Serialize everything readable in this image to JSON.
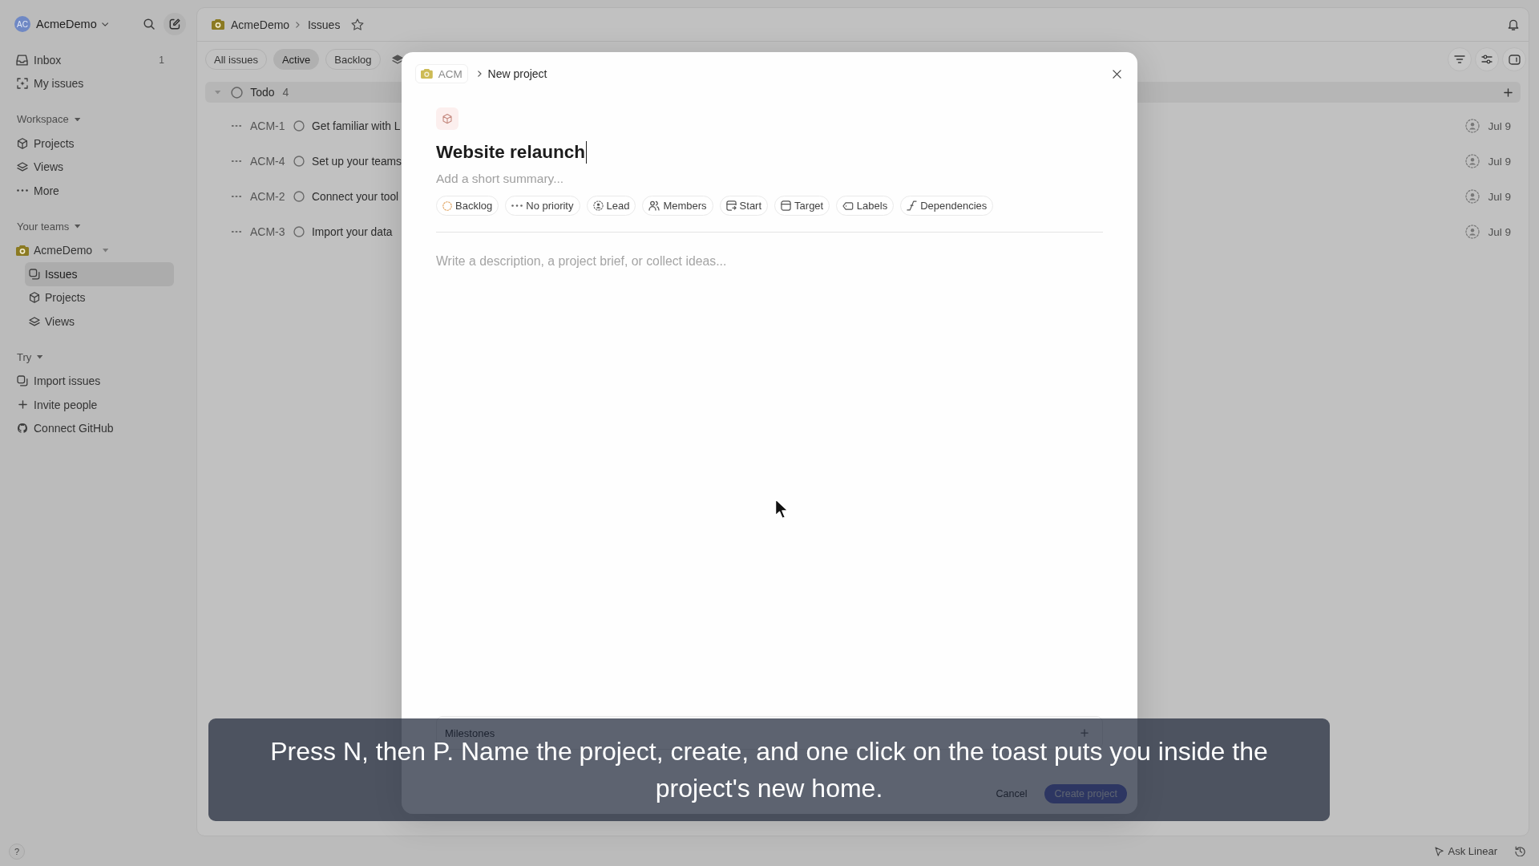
{
  "sidebar": {
    "workspace": {
      "initials": "AC",
      "name": "AcmeDemo"
    },
    "items": [
      {
        "label": "Inbox",
        "count": "1",
        "selected": false
      },
      {
        "label": "My issues",
        "selected": false
      }
    ],
    "sections": [
      {
        "title": "Workspace",
        "expanded": true,
        "items": [
          {
            "label": "Projects",
            "selected": false
          },
          {
            "label": "Views",
            "selected": false
          },
          {
            "label": "More",
            "selected": false
          }
        ]
      },
      {
        "title": "Your teams",
        "expanded": true,
        "items": [
          {
            "label": "AcmeDemo",
            "selected": false,
            "expanded": true,
            "children": [
              {
                "label": "Issues",
                "selected": true
              },
              {
                "label": "Projects",
                "selected": false
              },
              {
                "label": "Views",
                "selected": false
              }
            ]
          }
        ]
      },
      {
        "title": "Try",
        "expanded": true,
        "items": [
          {
            "label": "Import issues",
            "selected": false
          },
          {
            "label": "Invite people",
            "selected": false
          },
          {
            "label": "Connect GitHub",
            "selected": false
          }
        ]
      }
    ]
  },
  "main": {
    "breadcrumb": {
      "team": "AcmeDemo",
      "page": "Issues"
    },
    "tabs": [
      {
        "label": "All issues",
        "selected": false
      },
      {
        "label": "Active",
        "selected": true
      },
      {
        "label": "Backlog",
        "selected": false
      }
    ],
    "groups": [
      {
        "status": "Todo",
        "count": "4",
        "expanded": true,
        "issues": [
          {
            "id": "ACM-1",
            "title": "Get familiar with L",
            "date": "Jul 9"
          },
          {
            "id": "ACM-4",
            "title": "Set up your teams",
            "date": "Jul 9"
          },
          {
            "id": "ACM-2",
            "title": "Connect your tool",
            "date": "Jul 9"
          },
          {
            "id": "ACM-3",
            "title": "Import your data",
            "date": "Jul 9"
          }
        ]
      }
    ]
  },
  "modal": {
    "team": "ACM",
    "title": "New project",
    "name": {
      "value": "Website relaunch"
    },
    "summary": {
      "placeholder": "Add a short summary..."
    },
    "properties": [
      {
        "label": "Backlog"
      },
      {
        "label": "No priority"
      },
      {
        "label": "Lead"
      },
      {
        "label": "Members"
      },
      {
        "label": "Start"
      },
      {
        "label": "Target"
      },
      {
        "label": "Labels"
      },
      {
        "label": "Dependencies"
      }
    ],
    "description": {
      "placeholder": "Write a description, a project brief, or collect ideas..."
    },
    "milestones": {
      "label": "Milestones"
    },
    "buttons": [
      {
        "label": "Cancel",
        "kind": "secondary"
      },
      {
        "label": "Create project",
        "kind": "primary"
      }
    ]
  },
  "caption": {
    "text": "Press N, then P. Name the project, create, and one click on the toast puts you inside the project's new home."
  },
  "status_bar": {
    "help": "?",
    "assistant": "Ask Linear"
  }
}
